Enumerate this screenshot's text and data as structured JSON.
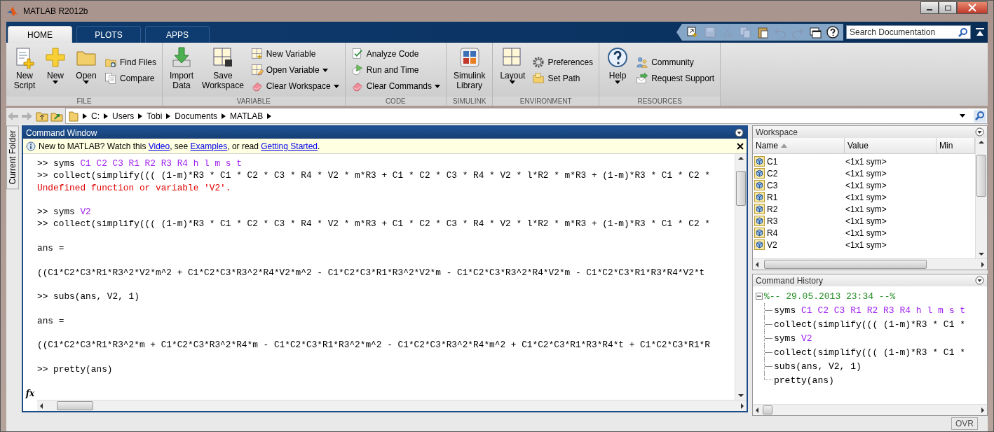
{
  "window": {
    "title": "MATLAB R2012b"
  },
  "ribbon_tabs": [
    {
      "label": "HOME",
      "selected": true
    },
    {
      "label": "PLOTS",
      "selected": false
    },
    {
      "label": "APPS",
      "selected": false
    }
  ],
  "quick_access": [
    {
      "kind": "shortcut",
      "disabled": false
    },
    {
      "kind": "save",
      "disabled": true
    },
    {
      "kind": "cut",
      "disabled": true
    },
    {
      "kind": "copy",
      "disabled": true
    },
    {
      "kind": "paste",
      "disabled": false
    },
    {
      "kind": "undo",
      "disabled": true
    },
    {
      "kind": "redo",
      "disabled": true
    },
    {
      "kind": "windows",
      "disabled": false
    },
    {
      "kind": "help",
      "disabled": false
    }
  ],
  "search": {
    "placeholder": "Search Documentation"
  },
  "ribbon_sections": [
    {
      "title": "FILE",
      "items": [
        {
          "kind": "large",
          "lines": [
            "New",
            "Script"
          ],
          "menu": false
        },
        {
          "kind": "large",
          "lines": [
            "New"
          ],
          "menu": true
        },
        {
          "kind": "large",
          "lines": [
            "Open"
          ],
          "menu": true
        },
        {
          "kind": "small",
          "lines": [
            "Find Files"
          ],
          "menu": false
        },
        {
          "kind": "small",
          "lines": [
            "Compare"
          ],
          "menu": false
        }
      ]
    },
    {
      "title": "VARIABLE",
      "items": [
        {
          "kind": "large",
          "lines": [
            "Import",
            "Data"
          ],
          "menu": false
        },
        {
          "kind": "large",
          "lines": [
            "Save",
            "Workspace"
          ],
          "menu": false
        },
        {
          "kind": "small",
          "lines": [
            "New Variable"
          ],
          "menu": false
        },
        {
          "kind": "small",
          "lines": [
            "Open Variable"
          ],
          "menu": true
        },
        {
          "kind": "small",
          "lines": [
            "Clear Workspace"
          ],
          "menu": true
        }
      ]
    },
    {
      "title": "CODE",
      "items": [
        {
          "kind": "small",
          "lines": [
            "Analyze Code"
          ],
          "menu": false
        },
        {
          "kind": "small",
          "lines": [
            "Run and Time"
          ],
          "menu": false
        },
        {
          "kind": "small",
          "lines": [
            "Clear Commands"
          ],
          "menu": true
        }
      ]
    },
    {
      "title": "SIMULINK",
      "items": [
        {
          "kind": "large",
          "lines": [
            "Simulink",
            "Library"
          ],
          "menu": false
        }
      ]
    },
    {
      "title": "ENVIRONMENT",
      "items": [
        {
          "kind": "large",
          "lines": [
            "Layout"
          ],
          "menu": true
        },
        {
          "kind": "small",
          "lines": [
            "Preferences"
          ],
          "menu": false
        },
        {
          "kind": "small",
          "lines": [
            "Set Path"
          ],
          "menu": false
        }
      ]
    },
    {
      "title": "RESOURCES",
      "items": [
        {
          "kind": "large",
          "lines": [
            "Help"
          ],
          "menu": true
        },
        {
          "kind": "small",
          "lines": [
            "Community"
          ],
          "menu": false
        },
        {
          "kind": "small",
          "lines": [
            "Request Support"
          ],
          "menu": false
        }
      ]
    }
  ],
  "nav_buttons": [
    {
      "kind": "back",
      "disabled": true
    },
    {
      "kind": "forward",
      "disabled": true
    },
    {
      "kind": "up",
      "disabled": false
    },
    {
      "kind": "browse",
      "disabled": false
    }
  ],
  "path": [
    "C:",
    "Users",
    "Tobi",
    "Documents",
    "MATLAB"
  ],
  "side_tab": {
    "label": "Current Folder"
  },
  "command_window": {
    "title": "Command Window",
    "info": [
      {
        "kind": "text",
        "text": "New to MATLAB? Watch this "
      },
      {
        "kind": "link",
        "text": "Video"
      },
      {
        "kind": "text",
        "text": ", see "
      },
      {
        "kind": "link",
        "text": "Examples"
      },
      {
        "kind": "text",
        "text": ", or read "
      },
      {
        "kind": "link",
        "text": "Getting Started"
      },
      {
        "kind": "text",
        "text": "."
      }
    ],
    "lines": [
      {
        "kind": "input",
        "parts": [
          {
            "kind": "plain",
            "text": ">> syms "
          },
          {
            "kind": "symbol",
            "text": "C1 C2 C3 R1 R2 R3 R4 h l m s t"
          }
        ]
      },
      {
        "kind": "input",
        "parts": [
          {
            "kind": "plain",
            "text": ">> collect(simplify((( (1-m)*R3 * C1 * C2 * C3 * R4 * V2 * m*R3 + C1 * C2 * C3 * R4 * V2 * l*R2 * m*R3 + (1-m)*R3 * C1 * C2 *"
          }
        ]
      },
      {
        "kind": "error",
        "parts": [
          {
            "kind": "error",
            "text": "Undefined function or variable 'V2'."
          }
        ]
      },
      {
        "kind": "blank"
      },
      {
        "kind": "input",
        "parts": [
          {
            "kind": "plain",
            "text": ">> syms "
          },
          {
            "kind": "symbol",
            "text": "V2"
          }
        ]
      },
      {
        "kind": "input",
        "parts": [
          {
            "kind": "plain",
            "text": ">> collect(simplify((( (1-m)*R3 * C1 * C2 * C3 * R4 * V2 * m*R3 + C1 * C2 * C3 * R4 * V2 * l*R2 * m*R3 + (1-m)*R3 * C1 * C2 *"
          }
        ]
      },
      {
        "kind": "blank"
      },
      {
        "kind": "output",
        "parts": [
          {
            "kind": "plain",
            "text": "ans ="
          }
        ]
      },
      {
        "kind": "blank"
      },
      {
        "kind": "output",
        "parts": [
          {
            "kind": "plain",
            "text": "((C1*C2*C3*R1*R3^2*V2*m^2 + C1*C2*C3*R3^2*R4*V2*m^2 - C1*C2*C3*R1*R3^2*V2*m - C1*C2*C3*R3^2*R4*V2*m - C1*C2*C3*R1*R3*R4*V2*t"
          }
        ]
      },
      {
        "kind": "blank"
      },
      {
        "kind": "input",
        "parts": [
          {
            "kind": "plain",
            "text": ">> subs(ans, V2, 1)"
          }
        ]
      },
      {
        "kind": "blank"
      },
      {
        "kind": "output",
        "parts": [
          {
            "kind": "plain",
            "text": "ans ="
          }
        ]
      },
      {
        "kind": "blank"
      },
      {
        "kind": "output",
        "parts": [
          {
            "kind": "plain",
            "text": "((C1*C2*C3*R1*R3^2*m + C1*C2*C3*R3^2*R4*m - C1*C2*C3*R1*R3^2*m^2 - C1*C2*C3*R3^2*R4*m^2 + C1*C2*C3*R1*R3*R4*t + C1*C2*C3*R1*R"
          }
        ]
      },
      {
        "kind": "blank"
      },
      {
        "kind": "input",
        "parts": [
          {
            "kind": "plain",
            "text": ">> pretty(ans)"
          }
        ]
      }
    ],
    "fx_label": "fx"
  },
  "workspace": {
    "title": "Workspace",
    "columns": [
      {
        "label": "Name",
        "sorted": true
      },
      {
        "label": "Value",
        "sorted": false
      },
      {
        "label": "Min",
        "sorted": false
      }
    ],
    "rows": [
      {
        "name": "C1",
        "value": "<1x1 sym>"
      },
      {
        "name": "C2",
        "value": "<1x1 sym>"
      },
      {
        "name": "C3",
        "value": "<1x1 sym>"
      },
      {
        "name": "R1",
        "value": "<1x1 sym>"
      },
      {
        "name": "R2",
        "value": "<1x1 sym>"
      },
      {
        "name": "R3",
        "value": "<1x1 sym>"
      },
      {
        "name": "R4",
        "value": "<1x1 sym>"
      },
      {
        "name": "V2",
        "value": "<1x1 sym>"
      }
    ]
  },
  "command_history": {
    "title": "Command History",
    "groups": [
      {
        "label": "%-- 29.05.2013 23:34 --%",
        "expanded": true,
        "children": [
          {
            "parts": [
              {
                "kind": "plain",
                "text": "syms "
              },
              {
                "kind": "symbol",
                "text": "C1 C2 C3 R1 R2 R3 R4 h l m s t"
              }
            ]
          },
          {
            "parts": [
              {
                "kind": "plain",
                "text": "collect(simplify((( (1-m)*R3 * C1 *"
              }
            ]
          },
          {
            "parts": [
              {
                "kind": "plain",
                "text": "syms "
              },
              {
                "kind": "symbol",
                "text": "V2"
              }
            ]
          },
          {
            "parts": [
              {
                "kind": "plain",
                "text": "collect(simplify((( (1-m)*R3 * C1 *"
              }
            ]
          },
          {
            "parts": [
              {
                "kind": "plain",
                "text": "subs(ans, V2, 1)"
              }
            ]
          },
          {
            "parts": [
              {
                "kind": "plain",
                "text": "pretty(ans)"
              }
            ]
          }
        ]
      }
    ]
  },
  "status_bar": {
    "mode": "OVR"
  }
}
